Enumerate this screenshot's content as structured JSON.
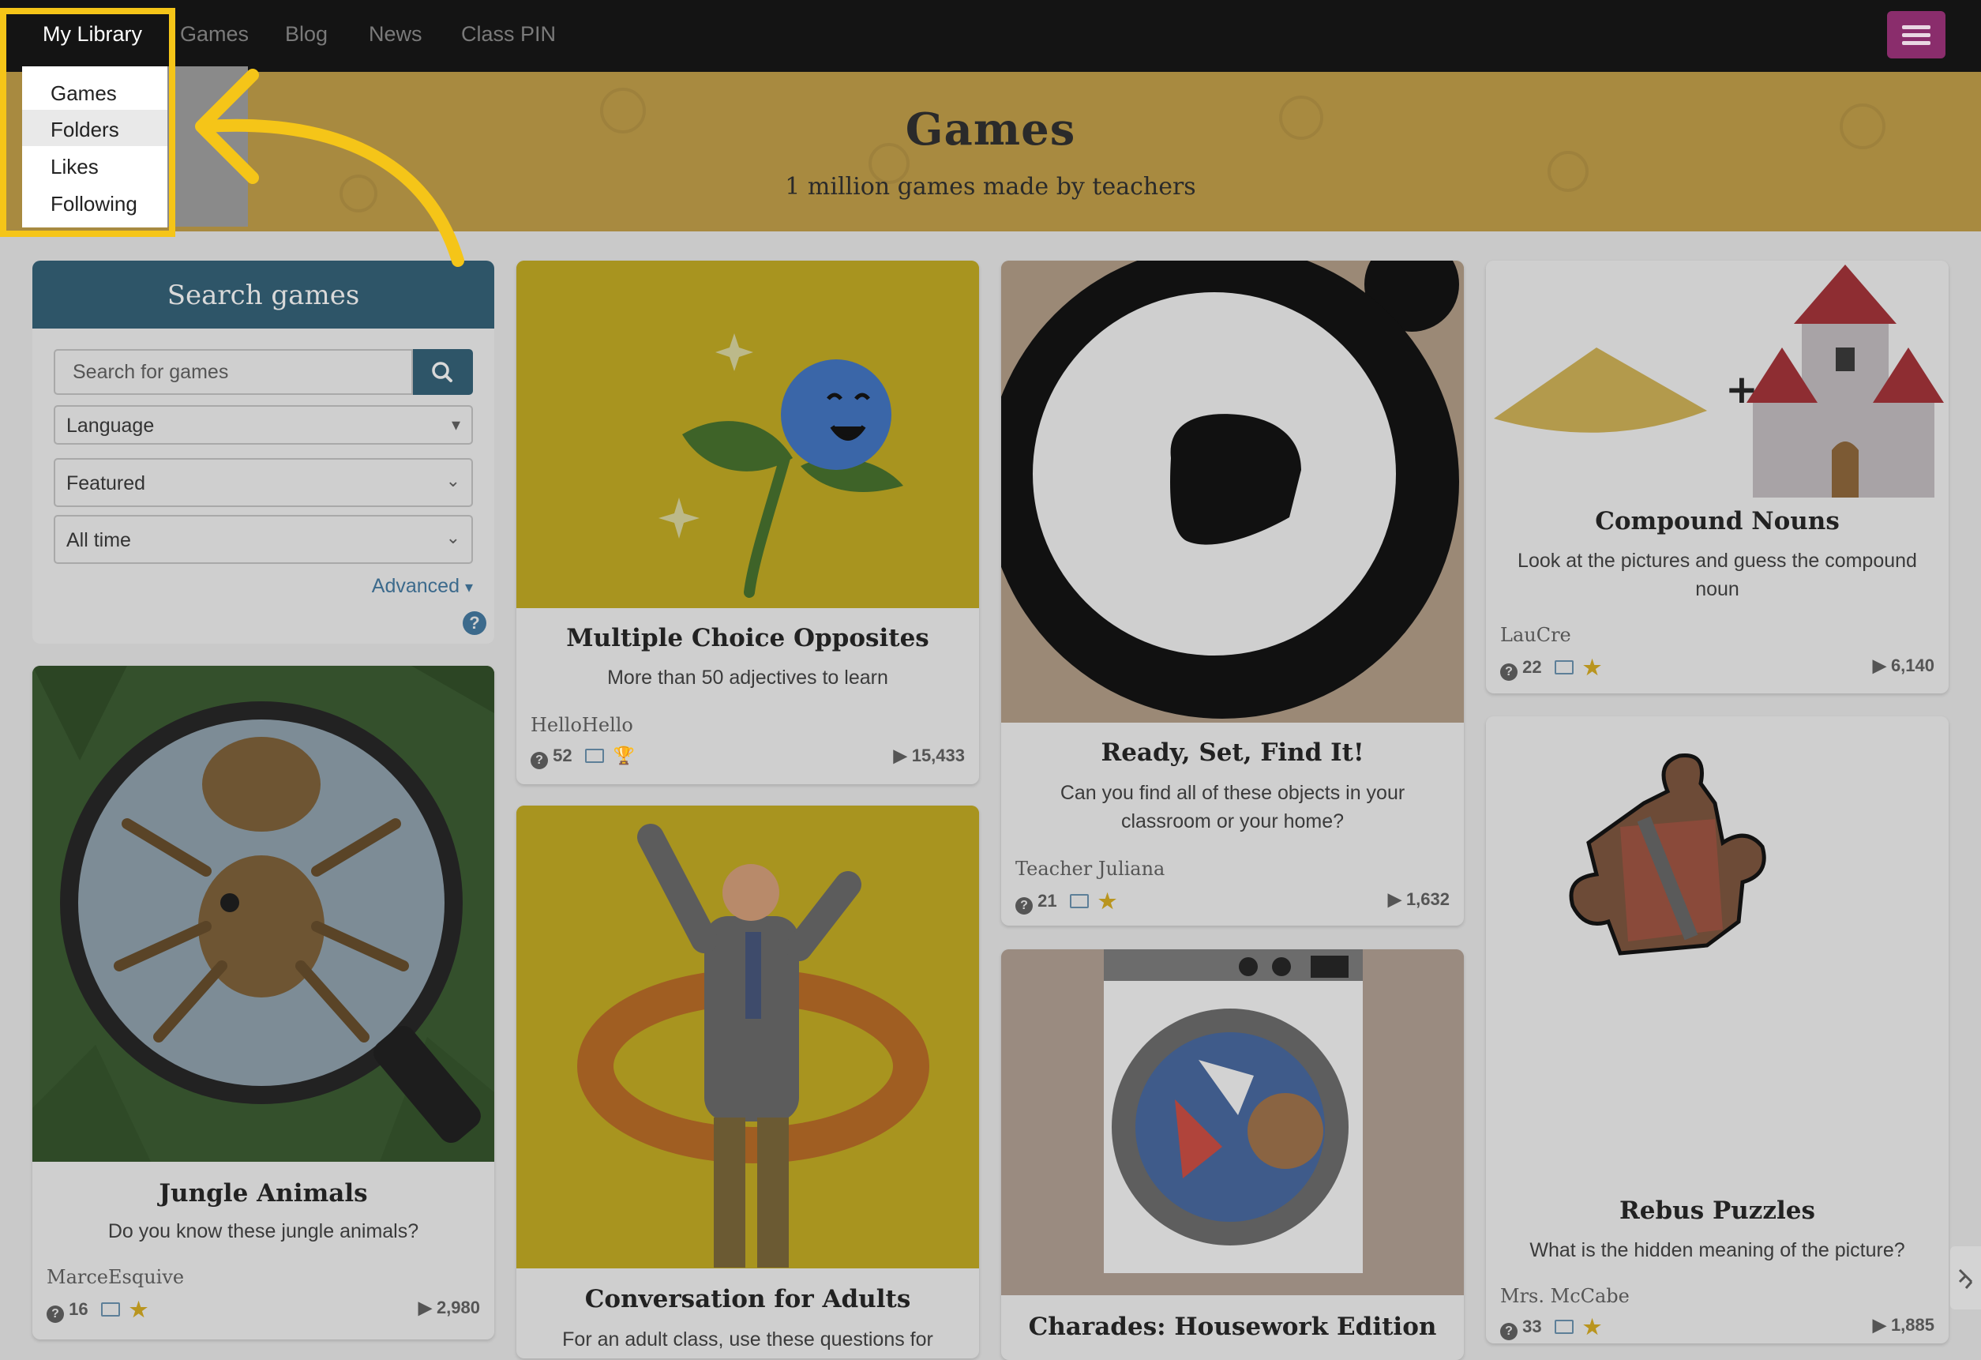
{
  "nav": {
    "library": "My Library",
    "links": [
      "Games",
      "Blog",
      "News",
      "Class PIN"
    ]
  },
  "library_menu": [
    "Games",
    "Folders",
    "Likes",
    "Following"
  ],
  "banner": {
    "title": "Games",
    "subtitle": "1 million games made by teachers"
  },
  "search": {
    "title": "Search games",
    "placeholder": "Search for games",
    "language": "Language",
    "sort": "Featured",
    "period": "All time",
    "advanced": "Advanced",
    "help": "?"
  },
  "cards": [
    {
      "title": "Jungle Animals",
      "desc": "Do you know these jungle animals?",
      "author": "MarceEsquive",
      "questions": "16",
      "plays": "2,980"
    },
    {
      "title": "Multiple Choice Opposites",
      "desc": "More than 50 adjectives to learn",
      "author": "HelloHello",
      "questions": "52",
      "plays": "15,433"
    },
    {
      "title": "Conversation for Adults",
      "desc": "For an adult class, use these questions for"
    },
    {
      "title": "Ready, Set, Find It!",
      "desc": "Can you find all of these objects in your classroom or your home?",
      "author": "Teacher Juliana",
      "questions": "21",
      "plays": "1,632"
    },
    {
      "title": "Charades: Housework Edition"
    },
    {
      "title": "Compound Nouns",
      "desc": "Look at the pictures and guess the compound noun",
      "author": "LauCre",
      "questions": "22",
      "plays": "6,140"
    },
    {
      "title": "Rebus Puzzles",
      "desc": "What is the hidden meaning of the picture?",
      "author": "Mrs. McCabe",
      "questions": "33",
      "plays": "1,885"
    }
  ],
  "colors": {
    "nav": "#141414",
    "banner": "#a88a40",
    "highlight": "#f5c518",
    "search_header": "#2e5568",
    "menu_button": "#8a2d6c"
  }
}
